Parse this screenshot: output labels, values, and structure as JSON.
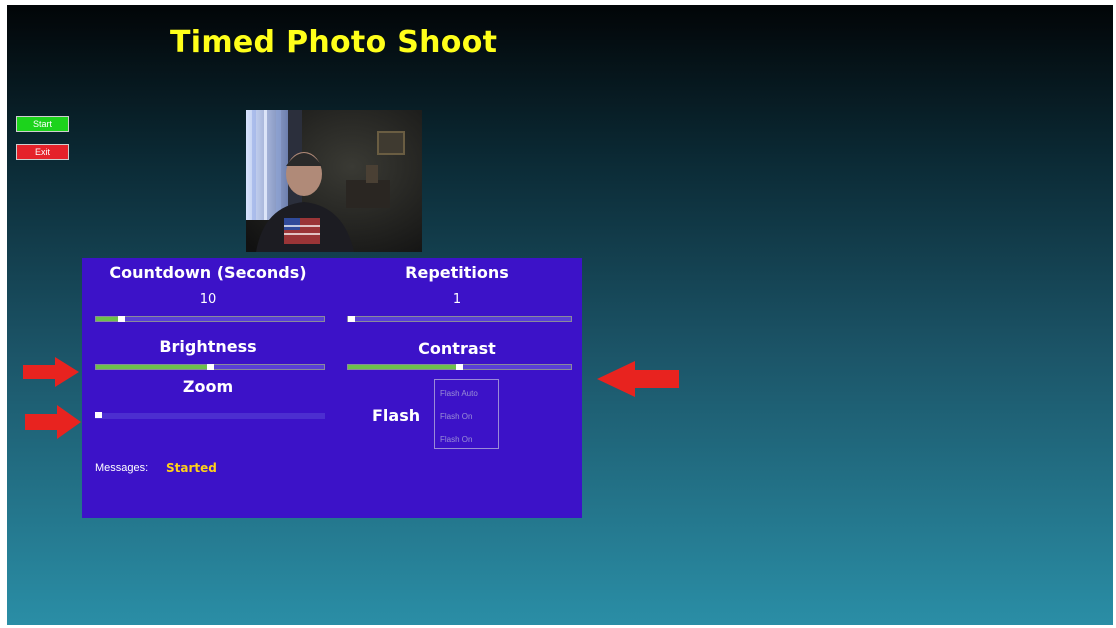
{
  "app": {
    "title": "Timed Photo Shoot"
  },
  "buttons": {
    "start": "Start",
    "exit": "Exit"
  },
  "camera": {
    "description_icon": "camera-preview-image"
  },
  "countdown": {
    "label": "Countdown (Seconds)",
    "value": "10",
    "slider_fraction": 0.1
  },
  "repetitions": {
    "label": "Repetitions",
    "value": "1",
    "slider_fraction": 0.0
  },
  "brightness": {
    "label": "Brightness",
    "slider_fraction": 0.5
  },
  "contrast": {
    "label": "Contrast",
    "slider_fraction": 0.5
  },
  "zoom": {
    "label": "Zoom",
    "slider_fraction": 0.0
  },
  "flash": {
    "label": "Flash",
    "options": [
      "Flash Auto",
      "Flash On",
      "Flash On"
    ]
  },
  "messages": {
    "label": "Messages:",
    "value": "Started"
  },
  "colors": {
    "title": "#ffff1a",
    "panel": "#3c12c8",
    "start_button": "#1cd31c",
    "exit_button": "#e5222a",
    "slider_fill": "#6cc04a",
    "arrow": "#e8231f",
    "message_value": "#ffd01a"
  },
  "annotations": {
    "arrow_icon": "red-arrow-icon"
  }
}
